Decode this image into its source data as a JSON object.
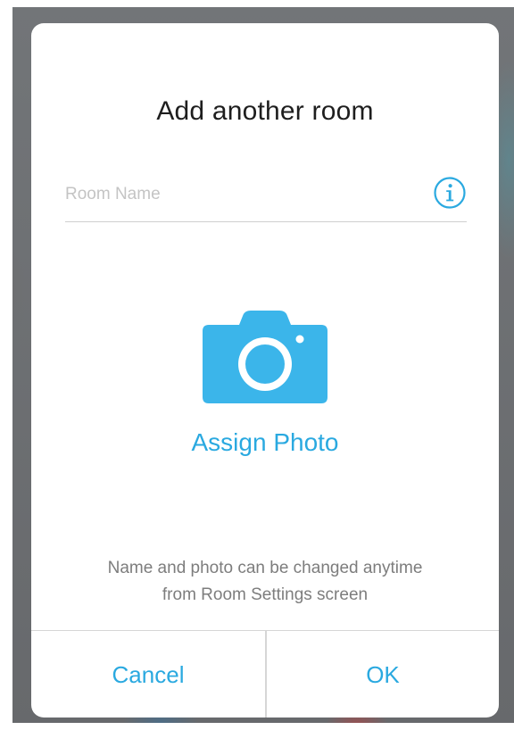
{
  "dialog": {
    "title": "Add another room",
    "room_name": {
      "value": "",
      "placeholder": "Room Name"
    },
    "info_icon": "info-circle-icon",
    "photo": {
      "icon": "camera-icon",
      "label": "Assign Photo"
    },
    "hint": {
      "line1": "Name and photo can be changed anytime",
      "line2": "from Room Settings screen"
    },
    "buttons": {
      "cancel": "Cancel",
      "ok": "OK"
    }
  },
  "colors": {
    "accent": "#2aa9e0",
    "camera": "#3bb5ea",
    "title": "#1e1e1e",
    "hint": "#7d7d7d",
    "divider": "#d6d6d6"
  }
}
